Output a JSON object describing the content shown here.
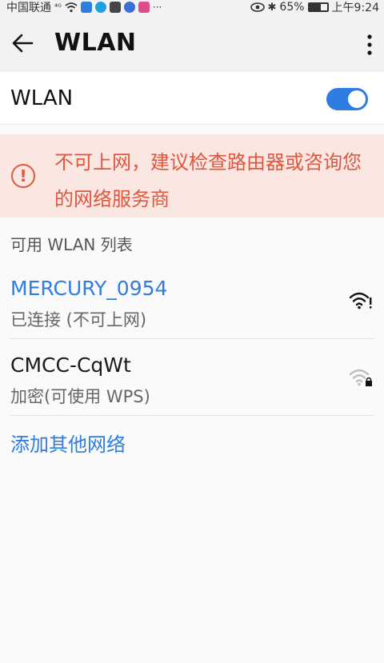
{
  "status_bar": {
    "carrier": "中国联通",
    "signal": "⁴ᴳ",
    "battery_percent": "65%",
    "battery_level": 0.65,
    "time": "上午9:24"
  },
  "app_bar": {
    "title": "WLAN"
  },
  "wlan_toggle": {
    "label": "WLAN",
    "enabled": true
  },
  "warning": {
    "text": "不可上网，建议检查路由器或咨询您的网络服务商"
  },
  "list": {
    "header": "可用 WLAN 列表",
    "networks": [
      {
        "name": "MERCURY_0954",
        "status": "已连接 (不可上网)",
        "connected": true,
        "icon": "wifi-warning-icon"
      },
      {
        "name": "CMCC-CqWt",
        "status": "加密(可使用 WPS)",
        "connected": false,
        "icon": "wifi-locked-icon"
      }
    ],
    "add_label": "添加其他网络"
  },
  "colors": {
    "accent": "#2f7de1",
    "warning": "#e0563f",
    "warning_bg": "#fbe7e2"
  }
}
